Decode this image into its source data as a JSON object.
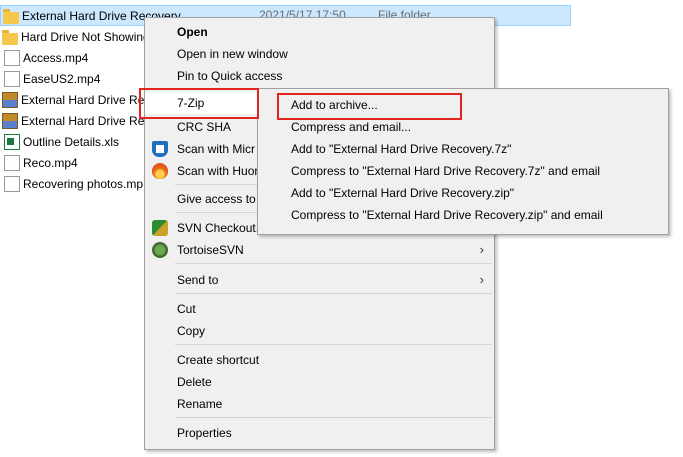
{
  "files": [
    {
      "name": "External Hard Drive Recovery",
      "icon": "folder-icon",
      "selected": true,
      "date": "2021/5/17 17:50",
      "type": "File folder"
    },
    {
      "name": "Hard Drive Not Showing",
      "icon": "folder-icon"
    },
    {
      "name": "Access.mp4",
      "icon": "document-icon"
    },
    {
      "name": "EaseUS2.mp4",
      "icon": "document-icon"
    },
    {
      "name": "External Hard Drive Rec",
      "icon": "archive-icon"
    },
    {
      "name": "External Hard Drive Rec",
      "icon": "archive-icon"
    },
    {
      "name": "Outline Details.xls",
      "icon": "excel-icon"
    },
    {
      "name": "Reco.mp4",
      "icon": "document-icon"
    },
    {
      "name": "Recovering photos.mp",
      "icon": "document-icon"
    }
  ],
  "context_menu": {
    "open": "Open",
    "open_new_window": "Open in new window",
    "pin_quick_access": "Pin to Quick access",
    "seven_zip": "7-Zip",
    "crc_sha": "CRC SHA",
    "scan_microsoft": "Scan with Micr",
    "scan_huorong": "Scan with Huor",
    "give_access": "Give access to",
    "svn_checkout": "SVN Checkout.",
    "tortoise_svn": "TortoiseSVN",
    "send_to": "Send to",
    "cut": "Cut",
    "copy": "Copy",
    "create_shortcut": "Create shortcut",
    "delete": "Delete",
    "rename": "Rename",
    "properties": "Properties",
    "arrow_glyph": "›"
  },
  "submenu": {
    "add_to_archive": "Add to archive...",
    "compress_email": "Compress and email...",
    "add_7z": "Add to \"External Hard Drive Recovery.7z\"",
    "compress_7z_email": "Compress to \"External Hard Drive Recovery.7z\" and email",
    "add_zip": "Add to \"External Hard Drive Recovery.zip\"",
    "compress_zip_email": "Compress to \"External Hard Drive Recovery.zip\" and email"
  },
  "colors": {
    "selection": "#cce8ff",
    "highlight_box": "#e0261e",
    "menu_background": "#f0f0f0"
  }
}
